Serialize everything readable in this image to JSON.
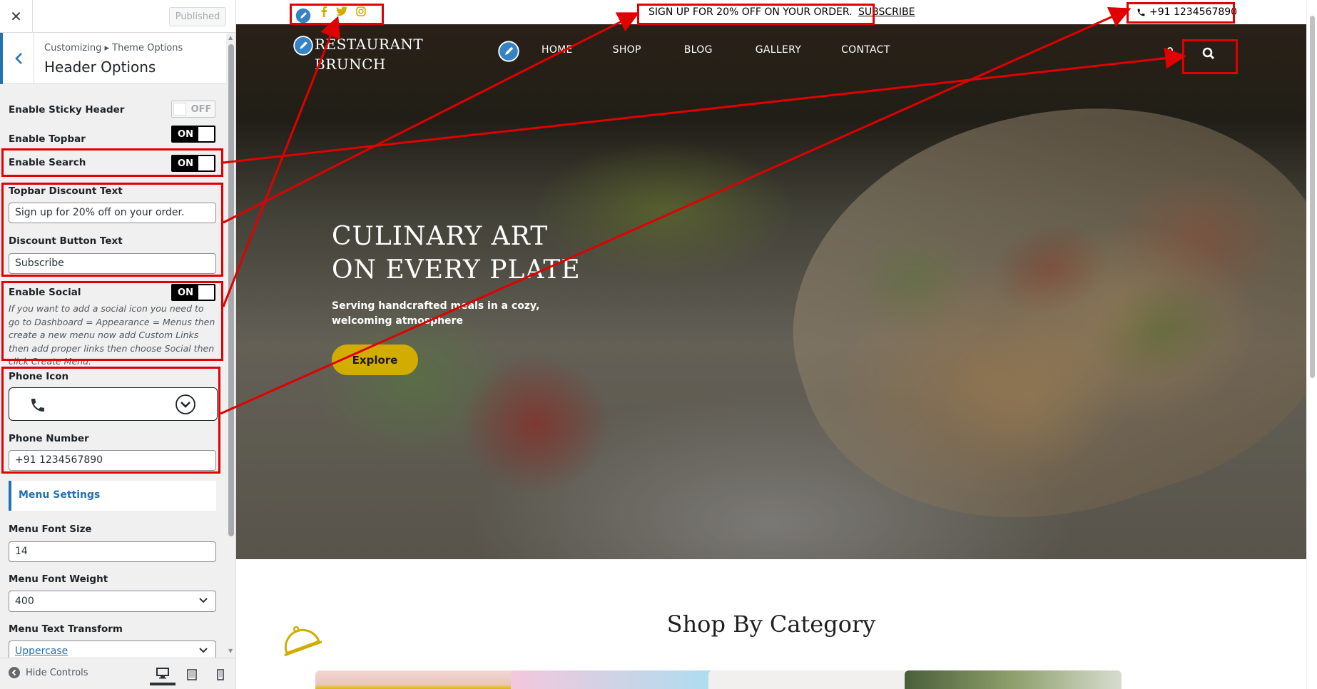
{
  "sidebar": {
    "close_icon": "close-icon",
    "published_label": "Published",
    "breadcrumb": "Customizing ▸ Theme Options",
    "section_title": "Header Options",
    "sticky": {
      "label": "Enable Sticky Header",
      "state": "OFF"
    },
    "topbar": {
      "label": "Enable Topbar",
      "state": "ON"
    },
    "search": {
      "label": "Enable Search",
      "state": "ON"
    },
    "discount": {
      "label": "Topbar Discount Text",
      "value": "Sign up for 20% off on your order."
    },
    "discount_button": {
      "label": "Discount Button Text",
      "value": "Subscribe"
    },
    "social": {
      "label": "Enable Social",
      "state": "ON",
      "description": "If you want to add a social icon you need to go to Dashboard = Appearance = Menus then create a new menu now add Custom Links then add proper links then choose Social then click Create Menu."
    },
    "phone_icon": {
      "label": "Phone Icon",
      "icon": "phone-icon"
    },
    "phone_number": {
      "label": "Phone Number",
      "value": "+91 1234567890"
    },
    "menu_settings": "Menu Settings",
    "menu_font_size": {
      "label": "Menu Font Size",
      "value": "14"
    },
    "menu_font_weight": {
      "label": "Menu Font Weight",
      "value": "400"
    },
    "menu_text_transform": {
      "label": "Menu Text Transform",
      "value": "Uppercase"
    },
    "hide_controls": "Hide Controls",
    "devices": [
      "desktop-icon",
      "tablet-icon",
      "mobile-icon"
    ],
    "accent": "#2271b1"
  },
  "preview": {
    "topbar_text": "SIGN UP FOR 20% OFF ON YOUR ORDER.",
    "topbar_link": "SUBSCRIBE",
    "phone": "+91 1234567890",
    "social_icons": [
      "facebook-icon",
      "twitter-icon",
      "instagram-icon"
    ],
    "logo_line1": "RESTAURANT",
    "logo_line2": "BRUNCH",
    "nav": [
      "HOME",
      "SHOP",
      "BLOG",
      "GALLERY",
      "CONTACT"
    ],
    "hero_title_1": "CULINARY ART",
    "hero_title_2": "ON EVERY PLATE",
    "hero_sub": "Serving handcrafted meals in a cozy, welcoming atmosphere",
    "explore": "Explore",
    "shop_title": "Shop By Category",
    "brand_gold": "#d2ad00",
    "annotation_red": "#e00000"
  }
}
